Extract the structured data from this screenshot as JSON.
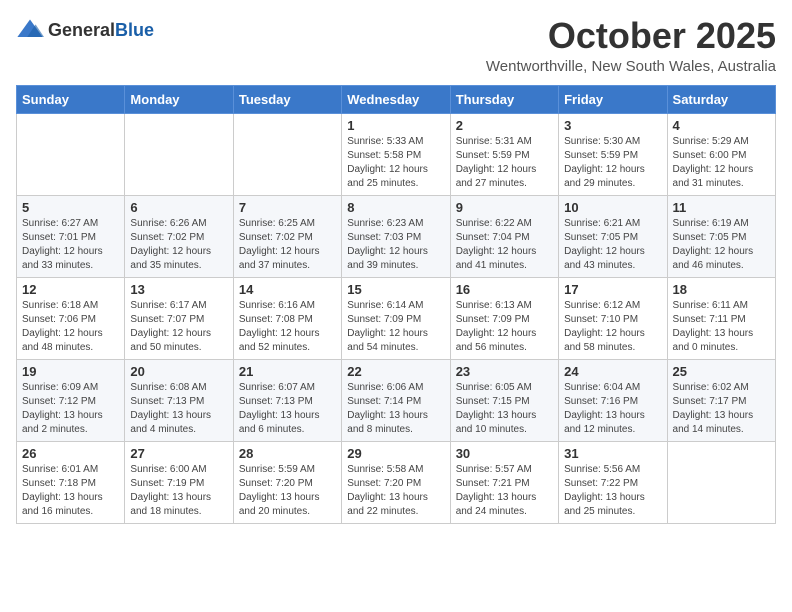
{
  "logo": {
    "general": "General",
    "blue": "Blue"
  },
  "title": "October 2025",
  "subtitle": "Wentworthville, New South Wales, Australia",
  "days_of_week": [
    "Sunday",
    "Monday",
    "Tuesday",
    "Wednesday",
    "Thursday",
    "Friday",
    "Saturday"
  ],
  "weeks": [
    [
      {
        "day": "",
        "info": ""
      },
      {
        "day": "",
        "info": ""
      },
      {
        "day": "",
        "info": ""
      },
      {
        "day": "1",
        "info": "Sunrise: 5:33 AM\nSunset: 5:58 PM\nDaylight: 12 hours\nand 25 minutes."
      },
      {
        "day": "2",
        "info": "Sunrise: 5:31 AM\nSunset: 5:59 PM\nDaylight: 12 hours\nand 27 minutes."
      },
      {
        "day": "3",
        "info": "Sunrise: 5:30 AM\nSunset: 5:59 PM\nDaylight: 12 hours\nand 29 minutes."
      },
      {
        "day": "4",
        "info": "Sunrise: 5:29 AM\nSunset: 6:00 PM\nDaylight: 12 hours\nand 31 minutes."
      }
    ],
    [
      {
        "day": "5",
        "info": "Sunrise: 6:27 AM\nSunset: 7:01 PM\nDaylight: 12 hours\nand 33 minutes."
      },
      {
        "day": "6",
        "info": "Sunrise: 6:26 AM\nSunset: 7:02 PM\nDaylight: 12 hours\nand 35 minutes."
      },
      {
        "day": "7",
        "info": "Sunrise: 6:25 AM\nSunset: 7:02 PM\nDaylight: 12 hours\nand 37 minutes."
      },
      {
        "day": "8",
        "info": "Sunrise: 6:23 AM\nSunset: 7:03 PM\nDaylight: 12 hours\nand 39 minutes."
      },
      {
        "day": "9",
        "info": "Sunrise: 6:22 AM\nSunset: 7:04 PM\nDaylight: 12 hours\nand 41 minutes."
      },
      {
        "day": "10",
        "info": "Sunrise: 6:21 AM\nSunset: 7:05 PM\nDaylight: 12 hours\nand 43 minutes."
      },
      {
        "day": "11",
        "info": "Sunrise: 6:19 AM\nSunset: 7:05 PM\nDaylight: 12 hours\nand 46 minutes."
      }
    ],
    [
      {
        "day": "12",
        "info": "Sunrise: 6:18 AM\nSunset: 7:06 PM\nDaylight: 12 hours\nand 48 minutes."
      },
      {
        "day": "13",
        "info": "Sunrise: 6:17 AM\nSunset: 7:07 PM\nDaylight: 12 hours\nand 50 minutes."
      },
      {
        "day": "14",
        "info": "Sunrise: 6:16 AM\nSunset: 7:08 PM\nDaylight: 12 hours\nand 52 minutes."
      },
      {
        "day": "15",
        "info": "Sunrise: 6:14 AM\nSunset: 7:09 PM\nDaylight: 12 hours\nand 54 minutes."
      },
      {
        "day": "16",
        "info": "Sunrise: 6:13 AM\nSunset: 7:09 PM\nDaylight: 12 hours\nand 56 minutes."
      },
      {
        "day": "17",
        "info": "Sunrise: 6:12 AM\nSunset: 7:10 PM\nDaylight: 12 hours\nand 58 minutes."
      },
      {
        "day": "18",
        "info": "Sunrise: 6:11 AM\nSunset: 7:11 PM\nDaylight: 13 hours\nand 0 minutes."
      }
    ],
    [
      {
        "day": "19",
        "info": "Sunrise: 6:09 AM\nSunset: 7:12 PM\nDaylight: 13 hours\nand 2 minutes."
      },
      {
        "day": "20",
        "info": "Sunrise: 6:08 AM\nSunset: 7:13 PM\nDaylight: 13 hours\nand 4 minutes."
      },
      {
        "day": "21",
        "info": "Sunrise: 6:07 AM\nSunset: 7:13 PM\nDaylight: 13 hours\nand 6 minutes."
      },
      {
        "day": "22",
        "info": "Sunrise: 6:06 AM\nSunset: 7:14 PM\nDaylight: 13 hours\nand 8 minutes."
      },
      {
        "day": "23",
        "info": "Sunrise: 6:05 AM\nSunset: 7:15 PM\nDaylight: 13 hours\nand 10 minutes."
      },
      {
        "day": "24",
        "info": "Sunrise: 6:04 AM\nSunset: 7:16 PM\nDaylight: 13 hours\nand 12 minutes."
      },
      {
        "day": "25",
        "info": "Sunrise: 6:02 AM\nSunset: 7:17 PM\nDaylight: 13 hours\nand 14 minutes."
      }
    ],
    [
      {
        "day": "26",
        "info": "Sunrise: 6:01 AM\nSunset: 7:18 PM\nDaylight: 13 hours\nand 16 minutes."
      },
      {
        "day": "27",
        "info": "Sunrise: 6:00 AM\nSunset: 7:19 PM\nDaylight: 13 hours\nand 18 minutes."
      },
      {
        "day": "28",
        "info": "Sunrise: 5:59 AM\nSunset: 7:20 PM\nDaylight: 13 hours\nand 20 minutes."
      },
      {
        "day": "29",
        "info": "Sunrise: 5:58 AM\nSunset: 7:20 PM\nDaylight: 13 hours\nand 22 minutes."
      },
      {
        "day": "30",
        "info": "Sunrise: 5:57 AM\nSunset: 7:21 PM\nDaylight: 13 hours\nand 24 minutes."
      },
      {
        "day": "31",
        "info": "Sunrise: 5:56 AM\nSunset: 7:22 PM\nDaylight: 13 hours\nand 25 minutes."
      },
      {
        "day": "",
        "info": ""
      }
    ]
  ]
}
